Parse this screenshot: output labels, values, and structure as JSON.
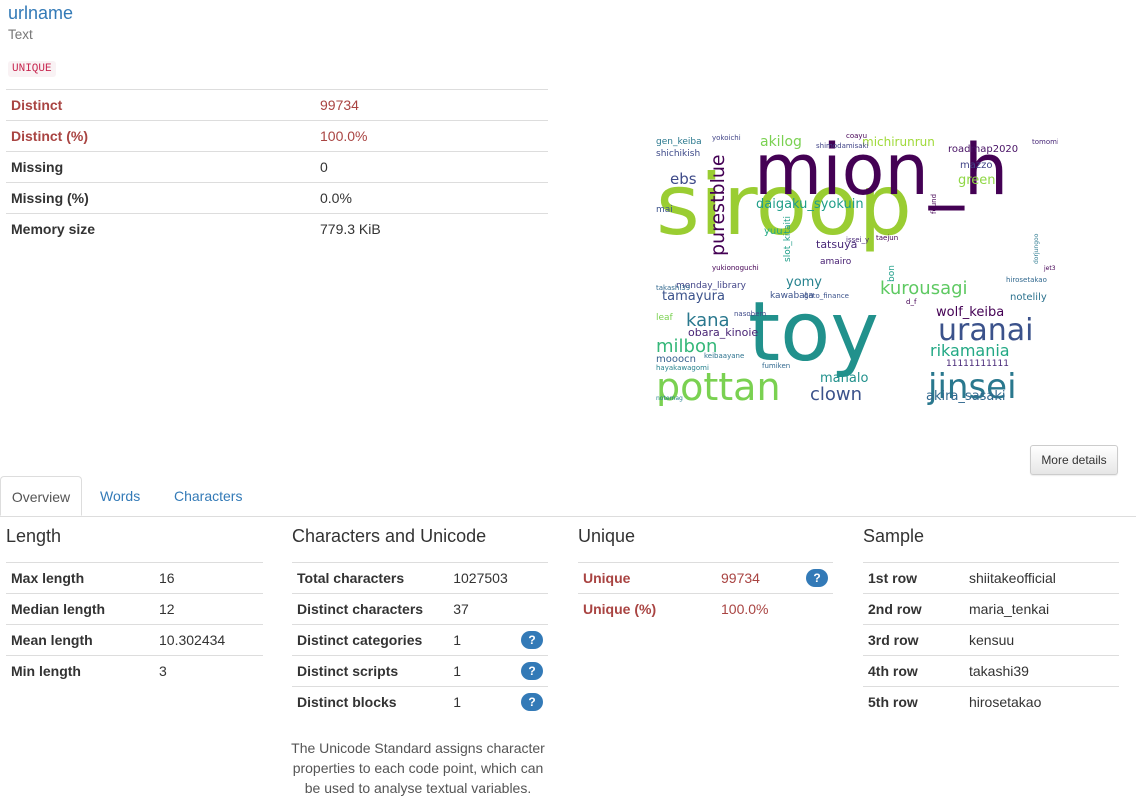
{
  "variable": {
    "name": "urlname",
    "type": "Text",
    "badge": "UNIQUE"
  },
  "stats": [
    {
      "label": "Distinct",
      "value": "99734",
      "alert": true
    },
    {
      "label": "Distinct (%)",
      "value": "100.0%",
      "alert": true
    },
    {
      "label": "Missing",
      "value": "0",
      "alert": false
    },
    {
      "label": "Missing (%)",
      "value": "0.0%",
      "alert": false
    },
    {
      "label": "Memory size",
      "value": "779.3 KiB",
      "alert": false
    }
  ],
  "more_details_label": "More details",
  "tabs": [
    "Overview",
    "Words",
    "Characters"
  ],
  "length": {
    "title": "Length",
    "rows": [
      {
        "label": "Max length",
        "value": "16"
      },
      {
        "label": "Median length",
        "value": "12"
      },
      {
        "label": "Mean length",
        "value": "10.302434"
      },
      {
        "label": "Min length",
        "value": "3"
      }
    ]
  },
  "unicode": {
    "title": "Characters and Unicode",
    "rows": [
      {
        "label": "Total characters",
        "value": "1027503",
        "help": false
      },
      {
        "label": "Distinct characters",
        "value": "37",
        "help": false
      },
      {
        "label": "Distinct categories",
        "value": "1",
        "help": true
      },
      {
        "label": "Distinct scripts",
        "value": "1",
        "help": true
      },
      {
        "label": "Distinct blocks",
        "value": "1",
        "help": true
      }
    ],
    "note": "The Unicode Standard assigns character properties to each code point, which can be used to analyse textual variables.",
    "help_glyph": "?"
  },
  "unique": {
    "title": "Unique",
    "rows": [
      {
        "label": "Unique",
        "value": "99734",
        "help": true
      },
      {
        "label": "Unique (%)",
        "value": "100.0%",
        "help": false
      }
    ]
  },
  "sample": {
    "title": "Sample",
    "rows": [
      {
        "label": "1st row",
        "value": "shiitakeofficial"
      },
      {
        "label": "2nd row",
        "value": "maria_tenkai"
      },
      {
        "label": "3rd row",
        "value": "kensuu"
      },
      {
        "label": "4th row",
        "value": "takashi39"
      },
      {
        "label": "5th row",
        "value": "hirosetakao"
      }
    ]
  },
  "wordcloud": {
    "words": [
      {
        "text": "siroop",
        "color": "#9acd32"
      },
      {
        "text": "mion_h",
        "color": "#440154"
      },
      {
        "text": "toy",
        "color": "#21918c"
      },
      {
        "text": "pottan",
        "color": "#7ad151"
      },
      {
        "text": "jinsei",
        "color": "#2a788e"
      },
      {
        "text": "uranai",
        "color": "#3b528b"
      },
      {
        "text": "purestblue",
        "color": "#440154"
      },
      {
        "text": "kurousagi",
        "color": "#5ec962"
      },
      {
        "text": "rikamania",
        "color": "#22a884"
      },
      {
        "text": "milbon",
        "color": "#35b779"
      },
      {
        "text": "clown",
        "color": "#3b528b"
      },
      {
        "text": "akira_sasaki",
        "color": "#31688e"
      },
      {
        "text": "daigaku_syokuin",
        "color": "#1f9e89"
      },
      {
        "text": "kana",
        "color": "#2a788e"
      },
      {
        "text": "akilog",
        "color": "#7ad151"
      },
      {
        "text": "michirunrun",
        "color": "#a0da39"
      },
      {
        "text": "wolf_keiba",
        "color": "#440154"
      },
      {
        "text": "tamayura",
        "color": "#3b528b"
      },
      {
        "text": "yomy",
        "color": "#26828e"
      },
      {
        "text": "ebs",
        "color": "#3e4a89"
      },
      {
        "text": "mahalo",
        "color": "#21918c"
      },
      {
        "text": "green",
        "color": "#8fd744"
      },
      {
        "text": "roadmap2020",
        "color": "#471164"
      },
      {
        "text": "tatsuya",
        "color": "#482878"
      },
      {
        "text": "notelily",
        "color": "#2c728e"
      },
      {
        "text": "monday_library",
        "color": "#414487"
      },
      {
        "text": "obara_kinoie",
        "color": "#482475"
      },
      {
        "text": "kawabata",
        "color": "#3b528b"
      },
      {
        "text": "amairo",
        "color": "#482173"
      },
      {
        "text": "mazzo",
        "color": "#414487"
      },
      {
        "text": "mooocn",
        "color": "#355f8d"
      },
      {
        "text": "slot_kitaiti",
        "color": "#1f9e89"
      },
      {
        "text": "yuu",
        "color": "#22a884"
      },
      {
        "text": "gen_keiba",
        "color": "#2a788e"
      },
      {
        "text": "shichikish",
        "color": "#3e4a89"
      },
      {
        "text": "takashi39",
        "color": "#31688e"
      },
      {
        "text": "hayakawagomi",
        "color": "#26828e"
      },
      {
        "text": "yukionoguchi",
        "color": "#440154"
      },
      {
        "text": "goto_finance",
        "color": "#3b528b"
      },
      {
        "text": "issei_y",
        "color": "#482878"
      },
      {
        "text": "taejun",
        "color": "#440154"
      },
      {
        "text": "hirosetakao",
        "color": "#31688e"
      },
      {
        "text": "leaf",
        "color": "#7ad151"
      },
      {
        "text": "mai",
        "color": "#3b528b"
      },
      {
        "text": "yokoichi",
        "color": "#414487"
      },
      {
        "text": "coayu",
        "color": "#440154"
      },
      {
        "text": "shimodamisaki",
        "color": "#414487"
      },
      {
        "text": "tomomisa",
        "color": "#482878"
      },
      {
        "text": "nasobem",
        "color": "#3e4a89"
      },
      {
        "text": "keibaayane",
        "color": "#2c728e"
      },
      {
        "text": "fumiken",
        "color": "#31688e"
      },
      {
        "text": "notemag",
        "color": "#26828e"
      },
      {
        "text": "d_f",
        "color": "#440154"
      },
      {
        "text": "11111111111",
        "color": "#482878"
      },
      {
        "text": "dorjungoo",
        "color": "#2a788e"
      },
      {
        "text": "jet3",
        "color": "#440154"
      },
      {
        "text": "found",
        "color": "#440154"
      },
      {
        "text": "bon",
        "color": "#1f9e89"
      }
    ]
  }
}
